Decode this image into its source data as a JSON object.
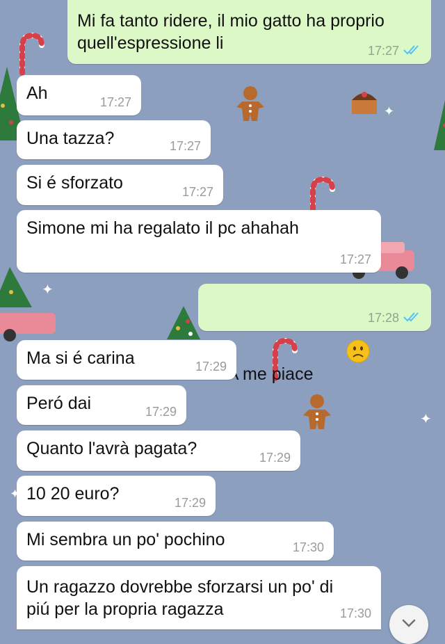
{
  "messages": [
    {
      "id": "m1",
      "dir": "out",
      "text": "Mi fa tanto ridere, il mio gatto ha proprio quell'espressione li",
      "time": "17:27",
      "read": true
    },
    {
      "id": "m2",
      "dir": "in",
      "text": "Ah",
      "time": "17:27"
    },
    {
      "id": "m3",
      "dir": "in",
      "text": "Una tazza?",
      "time": "17:27"
    },
    {
      "id": "m4",
      "dir": "in",
      "text": "Si é sforzato",
      "time": "17:27"
    },
    {
      "id": "m5",
      "dir": "in",
      "text": "Simone mi ha regalato il pc ahahah",
      "time": "17:27"
    },
    {
      "id": "m6",
      "dir": "out",
      "text": "A me piace",
      "emoji": "frowning-face",
      "time": "17:28",
      "read": true
    },
    {
      "id": "m7",
      "dir": "in",
      "text": "Ma si é carina",
      "time": "17:29"
    },
    {
      "id": "m8",
      "dir": "in",
      "text": "Peró dai",
      "time": "17:29"
    },
    {
      "id": "m9",
      "dir": "in",
      "text": "Quanto l'avrà pagata?",
      "time": "17:29"
    },
    {
      "id": "m10",
      "dir": "in",
      "text": "10 20 euro?",
      "time": "17:29"
    },
    {
      "id": "m11",
      "dir": "in",
      "text": "Mi sembra un po' pochino",
      "time": "17:30"
    },
    {
      "id": "m12",
      "dir": "in",
      "text": "Un ragazzo dovrebbe sforzarsi un po' di piú per la propria ragazza",
      "time": "17:30"
    }
  ],
  "colors": {
    "wallpaper": "#8c9fbe",
    "incoming_bubble": "#ffffff",
    "outgoing_bubble": "#dcf8c6",
    "read_ticks": "#4fc3f7"
  },
  "scroll_button_icon": "chevron-down-icon"
}
